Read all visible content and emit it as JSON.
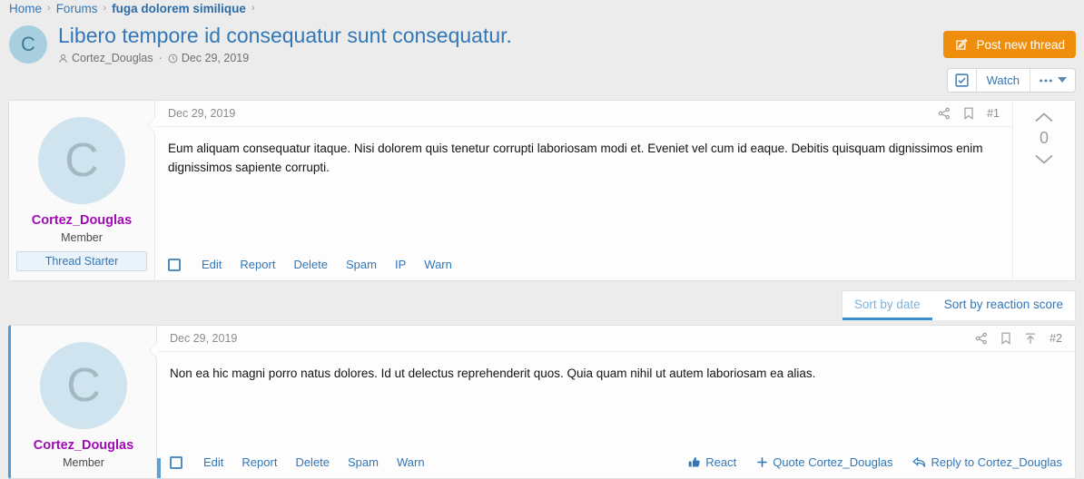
{
  "breadcrumb": {
    "items": [
      {
        "label": "Home",
        "strong": false
      },
      {
        "label": "Forums",
        "strong": false
      },
      {
        "label": "fuga dolorem similique",
        "strong": true
      }
    ],
    "separator": "›"
  },
  "thread": {
    "title": "Libero tempore id consequatur sunt consequatur.",
    "avatar_letter": "C",
    "author": "Cortez_Douglas",
    "meta_separator": "·",
    "date": "Dec 29, 2019",
    "author_icon": "user-icon",
    "date_icon": "clock-icon"
  },
  "toolbar": {
    "post_new_thread_label": "Post new thread",
    "post_new_thread_icon": "compose-icon",
    "accent_color": "#ef8d0c",
    "watch_label": "Watch",
    "watch_icon": "checkbox-checked-icon",
    "more_icon": "ellipsis-caret-icon"
  },
  "sort": {
    "tabs": [
      {
        "label": "Sort by date",
        "active": true
      },
      {
        "label": "Sort by reaction score",
        "active": false
      }
    ]
  },
  "posts": [
    {
      "user": {
        "avatar_letter": "C",
        "name": "Cortez_Douglas",
        "title": "Member",
        "banner": "Thread Starter",
        "name_color": "#a10bb4"
      },
      "date": "Dec 29, 2019",
      "number": "#1",
      "body": "Eum aliquam consequatur itaque. Nisi dolorem quis tenetur corrupti laboriosam modi et. Eveniet vel cum id eaque. Debitis quisquam dignissimos enim dignissimos sapiente corrupti.",
      "head_icons": [
        "share-icon",
        "bookmark-icon"
      ],
      "actions": [
        "Edit",
        "Report",
        "Delete",
        "Spam",
        "IP",
        "Warn"
      ],
      "right_actions": [],
      "vote": {
        "count": "0",
        "up_icon": "chevron-up-icon",
        "down_icon": "chevron-down-icon"
      },
      "unread": false,
      "has_vote_column": true
    },
    {
      "user": {
        "avatar_letter": "C",
        "name": "Cortez_Douglas",
        "title": "Member",
        "banner": null,
        "name_color": "#a10bb4"
      },
      "date": "Dec 29, 2019",
      "number": "#2",
      "body": "Non ea hic magni porro natus dolores. Id ut delectus reprehenderit quos. Quia quam nihil ut autem laboriosam ea alias.",
      "head_icons": [
        "share-icon",
        "bookmark-icon",
        "jump-to-first-unread-icon"
      ],
      "actions": [
        "Edit",
        "Report",
        "Delete",
        "Spam",
        "Warn"
      ],
      "right_actions": [
        {
          "label": "React",
          "icon": "thumbs-up-icon"
        },
        {
          "label": "Quote Cortez_Douglas",
          "icon": "plus-icon"
        },
        {
          "label": "Reply to Cortez_Douglas",
          "icon": "reply-icon"
        }
      ],
      "vote": null,
      "unread": true,
      "has_vote_column": false
    }
  ]
}
